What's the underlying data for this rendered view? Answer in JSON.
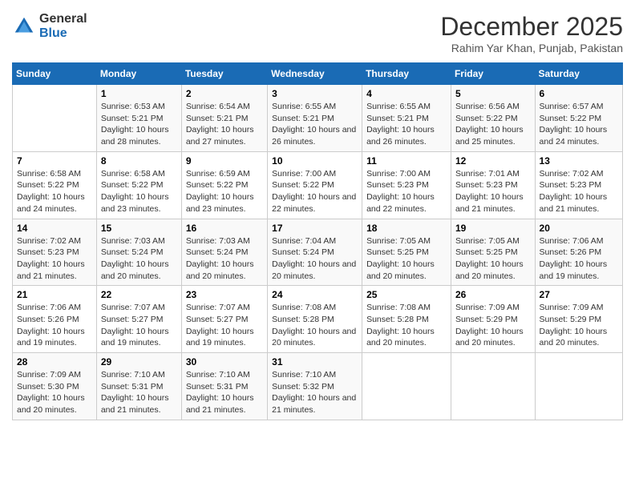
{
  "logo": {
    "general": "General",
    "blue": "Blue"
  },
  "title": "December 2025",
  "subtitle": "Rahim Yar Khan, Punjab, Pakistan",
  "header_days": [
    "Sunday",
    "Monday",
    "Tuesday",
    "Wednesday",
    "Thursday",
    "Friday",
    "Saturday"
  ],
  "weeks": [
    [
      {
        "day": "",
        "sunrise": "",
        "sunset": "",
        "daylight": ""
      },
      {
        "day": "1",
        "sunrise": "Sunrise: 6:53 AM",
        "sunset": "Sunset: 5:21 PM",
        "daylight": "Daylight: 10 hours and 28 minutes."
      },
      {
        "day": "2",
        "sunrise": "Sunrise: 6:54 AM",
        "sunset": "Sunset: 5:21 PM",
        "daylight": "Daylight: 10 hours and 27 minutes."
      },
      {
        "day": "3",
        "sunrise": "Sunrise: 6:55 AM",
        "sunset": "Sunset: 5:21 PM",
        "daylight": "Daylight: 10 hours and 26 minutes."
      },
      {
        "day": "4",
        "sunrise": "Sunrise: 6:55 AM",
        "sunset": "Sunset: 5:21 PM",
        "daylight": "Daylight: 10 hours and 26 minutes."
      },
      {
        "day": "5",
        "sunrise": "Sunrise: 6:56 AM",
        "sunset": "Sunset: 5:22 PM",
        "daylight": "Daylight: 10 hours and 25 minutes."
      },
      {
        "day": "6",
        "sunrise": "Sunrise: 6:57 AM",
        "sunset": "Sunset: 5:22 PM",
        "daylight": "Daylight: 10 hours and 24 minutes."
      }
    ],
    [
      {
        "day": "7",
        "sunrise": "Sunrise: 6:58 AM",
        "sunset": "Sunset: 5:22 PM",
        "daylight": "Daylight: 10 hours and 24 minutes."
      },
      {
        "day": "8",
        "sunrise": "Sunrise: 6:58 AM",
        "sunset": "Sunset: 5:22 PM",
        "daylight": "Daylight: 10 hours and 23 minutes."
      },
      {
        "day": "9",
        "sunrise": "Sunrise: 6:59 AM",
        "sunset": "Sunset: 5:22 PM",
        "daylight": "Daylight: 10 hours and 23 minutes."
      },
      {
        "day": "10",
        "sunrise": "Sunrise: 7:00 AM",
        "sunset": "Sunset: 5:22 PM",
        "daylight": "Daylight: 10 hours and 22 minutes."
      },
      {
        "day": "11",
        "sunrise": "Sunrise: 7:00 AM",
        "sunset": "Sunset: 5:23 PM",
        "daylight": "Daylight: 10 hours and 22 minutes."
      },
      {
        "day": "12",
        "sunrise": "Sunrise: 7:01 AM",
        "sunset": "Sunset: 5:23 PM",
        "daylight": "Daylight: 10 hours and 21 minutes."
      },
      {
        "day": "13",
        "sunrise": "Sunrise: 7:02 AM",
        "sunset": "Sunset: 5:23 PM",
        "daylight": "Daylight: 10 hours and 21 minutes."
      }
    ],
    [
      {
        "day": "14",
        "sunrise": "Sunrise: 7:02 AM",
        "sunset": "Sunset: 5:23 PM",
        "daylight": "Daylight: 10 hours and 21 minutes."
      },
      {
        "day": "15",
        "sunrise": "Sunrise: 7:03 AM",
        "sunset": "Sunset: 5:24 PM",
        "daylight": "Daylight: 10 hours and 20 minutes."
      },
      {
        "day": "16",
        "sunrise": "Sunrise: 7:03 AM",
        "sunset": "Sunset: 5:24 PM",
        "daylight": "Daylight: 10 hours and 20 minutes."
      },
      {
        "day": "17",
        "sunrise": "Sunrise: 7:04 AM",
        "sunset": "Sunset: 5:24 PM",
        "daylight": "Daylight: 10 hours and 20 minutes."
      },
      {
        "day": "18",
        "sunrise": "Sunrise: 7:05 AM",
        "sunset": "Sunset: 5:25 PM",
        "daylight": "Daylight: 10 hours and 20 minutes."
      },
      {
        "day": "19",
        "sunrise": "Sunrise: 7:05 AM",
        "sunset": "Sunset: 5:25 PM",
        "daylight": "Daylight: 10 hours and 20 minutes."
      },
      {
        "day": "20",
        "sunrise": "Sunrise: 7:06 AM",
        "sunset": "Sunset: 5:26 PM",
        "daylight": "Daylight: 10 hours and 19 minutes."
      }
    ],
    [
      {
        "day": "21",
        "sunrise": "Sunrise: 7:06 AM",
        "sunset": "Sunset: 5:26 PM",
        "daylight": "Daylight: 10 hours and 19 minutes."
      },
      {
        "day": "22",
        "sunrise": "Sunrise: 7:07 AM",
        "sunset": "Sunset: 5:27 PM",
        "daylight": "Daylight: 10 hours and 19 minutes."
      },
      {
        "day": "23",
        "sunrise": "Sunrise: 7:07 AM",
        "sunset": "Sunset: 5:27 PM",
        "daylight": "Daylight: 10 hours and 19 minutes."
      },
      {
        "day": "24",
        "sunrise": "Sunrise: 7:08 AM",
        "sunset": "Sunset: 5:28 PM",
        "daylight": "Daylight: 10 hours and 20 minutes."
      },
      {
        "day": "25",
        "sunrise": "Sunrise: 7:08 AM",
        "sunset": "Sunset: 5:28 PM",
        "daylight": "Daylight: 10 hours and 20 minutes."
      },
      {
        "day": "26",
        "sunrise": "Sunrise: 7:09 AM",
        "sunset": "Sunset: 5:29 PM",
        "daylight": "Daylight: 10 hours and 20 minutes."
      },
      {
        "day": "27",
        "sunrise": "Sunrise: 7:09 AM",
        "sunset": "Sunset: 5:29 PM",
        "daylight": "Daylight: 10 hours and 20 minutes."
      }
    ],
    [
      {
        "day": "28",
        "sunrise": "Sunrise: 7:09 AM",
        "sunset": "Sunset: 5:30 PM",
        "daylight": "Daylight: 10 hours and 20 minutes."
      },
      {
        "day": "29",
        "sunrise": "Sunrise: 7:10 AM",
        "sunset": "Sunset: 5:31 PM",
        "daylight": "Daylight: 10 hours and 21 minutes."
      },
      {
        "day": "30",
        "sunrise": "Sunrise: 7:10 AM",
        "sunset": "Sunset: 5:31 PM",
        "daylight": "Daylight: 10 hours and 21 minutes."
      },
      {
        "day": "31",
        "sunrise": "Sunrise: 7:10 AM",
        "sunset": "Sunset: 5:32 PM",
        "daylight": "Daylight: 10 hours and 21 minutes."
      },
      {
        "day": "",
        "sunrise": "",
        "sunset": "",
        "daylight": ""
      },
      {
        "day": "",
        "sunrise": "",
        "sunset": "",
        "daylight": ""
      },
      {
        "day": "",
        "sunrise": "",
        "sunset": "",
        "daylight": ""
      }
    ]
  ]
}
